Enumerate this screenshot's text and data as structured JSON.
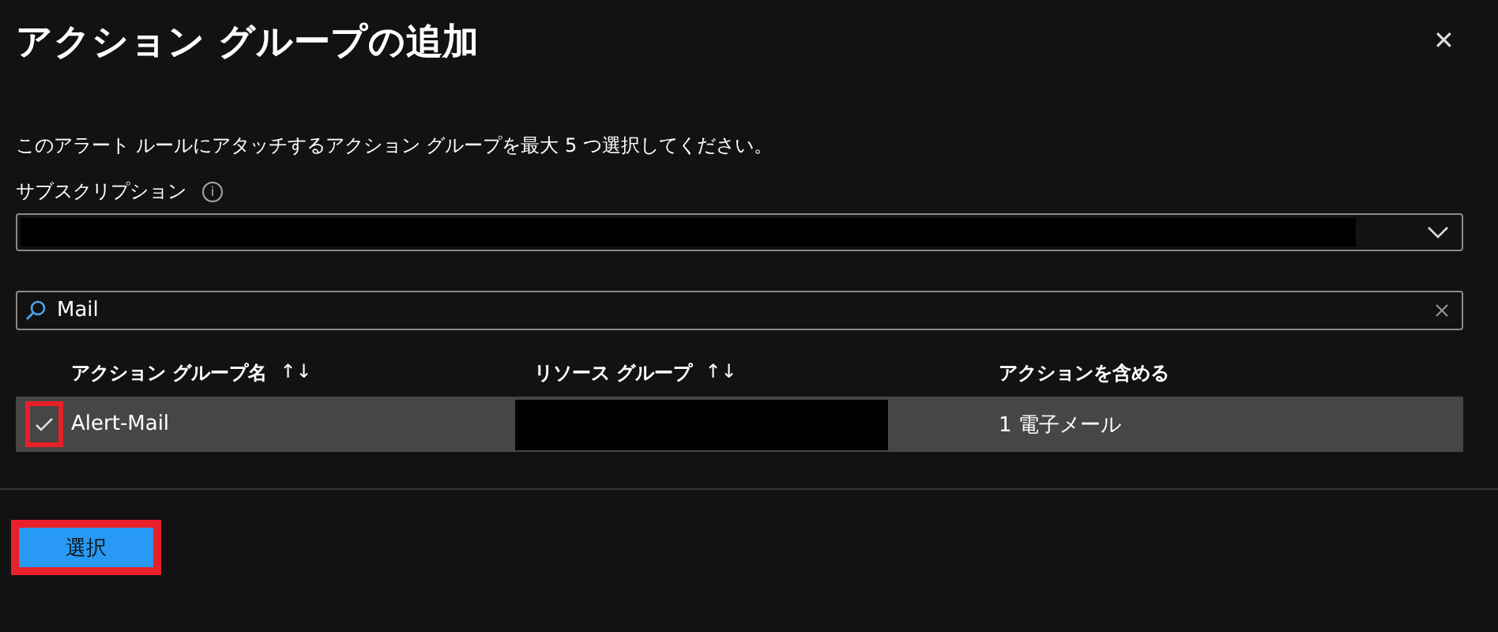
{
  "panel": {
    "title": "アクション グループの追加",
    "close_icon": "✕"
  },
  "description": "このアラート ルールにアタッチするアクション グループを最大 5 つ選択してください。",
  "subscription": {
    "label": "サブスクリプション",
    "info_icon": "i",
    "redacted": true
  },
  "search": {
    "value": "Mail"
  },
  "table": {
    "columns": [
      {
        "label": "アクション グループ名",
        "sort_icon": "↑↓"
      },
      {
        "label": "リソース グループ",
        "sort_icon": "↑↓"
      },
      {
        "label": "アクションを含める"
      }
    ],
    "rows": [
      {
        "selected": true,
        "name": "Alert-Mail",
        "resource_group_redacted": true,
        "actions": "1 電子メール"
      }
    ]
  },
  "buttons": [
    {
      "label": "選択",
      "kind": "primary",
      "highlighted": true
    }
  ]
}
